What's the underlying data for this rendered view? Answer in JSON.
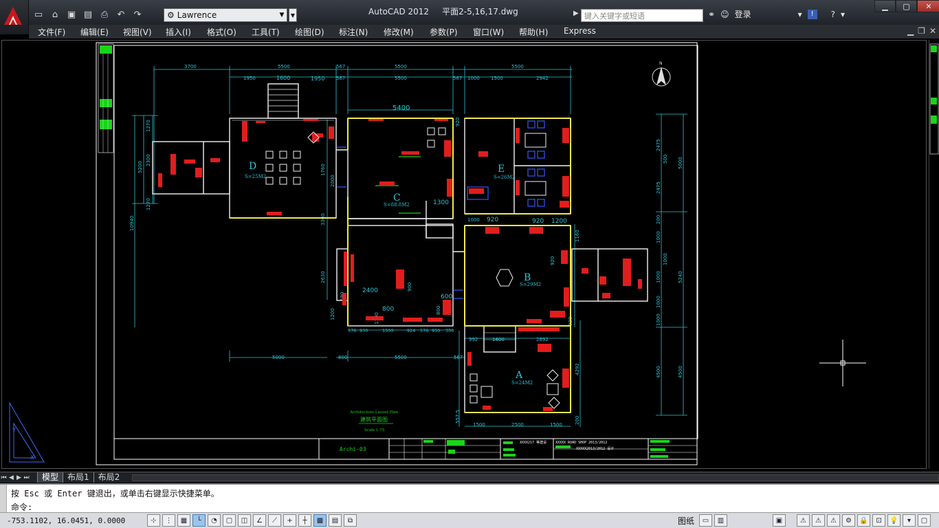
{
  "window": {
    "app_name": "AutoCAD 2012",
    "file_name": "平面2-5,16,17.dwg",
    "workspace": "Lawrence",
    "search_placeholder": "键入关键字或短语",
    "login": "登录"
  },
  "menu": [
    "文件(F)",
    "编辑(E)",
    "视图(V)",
    "插入(I)",
    "格式(O)",
    "工具(T)",
    "绘图(D)",
    "标注(N)",
    "修改(M)",
    "参数(P)",
    "窗口(W)",
    "帮助(H)",
    "Express"
  ],
  "tabs": [
    "模型",
    "布局1",
    "布局2"
  ],
  "active_tab": "模型",
  "command": {
    "history": "按 Esc 或 Enter 键退出，或单击右键显示快捷菜单。",
    "prompt": "命令:"
  },
  "status": {
    "coordinates": "-753.1102, 16.0451, 0.0000",
    "paper_label": "图纸"
  },
  "drawing": {
    "rooms": [
      {
        "label": "D",
        "area": "S=25M2"
      },
      {
        "label": "C",
        "area": "S=88.8M2"
      },
      {
        "label": "E",
        "area": "S=26M2"
      },
      {
        "label": "B",
        "area": "S=29M2"
      },
      {
        "label": "A",
        "area": "S=24M2"
      }
    ],
    "north": "N",
    "title_en": "Architecture Layout Plan",
    "title_cn": "建筑平面图",
    "scale": "Scale 1:75",
    "sheet_code": "Archi-03",
    "title_block_texts": [
      "XXXX217 等建设",
      "XXXXX ROAD SHOP 2013/2012",
      "XXXXX2013/2012 设计"
    ],
    "dims_top_outer": [
      "3700",
      "5500",
      "567",
      "5500",
      "5500"
    ],
    "dims_top_inner": [
      "1950",
      "1600",
      "1950",
      "567",
      "5500",
      "567",
      "1000",
      "1500",
      "2942"
    ],
    "dims_c": [
      "5400",
      "1300"
    ],
    "dims_b": [
      "920",
      "920",
      "1200",
      "1160",
      "920",
      "920"
    ],
    "dims_bottom": [
      "5000",
      "800",
      "5500",
      "567"
    ],
    "dims_bottom_row": [
      "576",
      "930",
      "1500",
      "924",
      "576",
      "950",
      "350"
    ],
    "dims_a": [
      "992",
      "1600",
      "2892",
      "4292",
      "557.5",
      "1500",
      "2500",
      "1500",
      "200"
    ],
    "dims_left": [
      "1270",
      "2300",
      "1270",
      "5200",
      "10940",
      "1760",
      "2000",
      "3300",
      "2630",
      "590",
      "1200"
    ],
    "dims_right": [
      "2475",
      "500",
      "2475",
      "5000",
      "200",
      "1000",
      "1000",
      "5240",
      "1000",
      "1000",
      "1000",
      "4500",
      "4500"
    ],
    "dims_misc": [
      "2400",
      "900",
      "800",
      "600",
      "800",
      "1000",
      "920",
      "1100"
    ]
  }
}
